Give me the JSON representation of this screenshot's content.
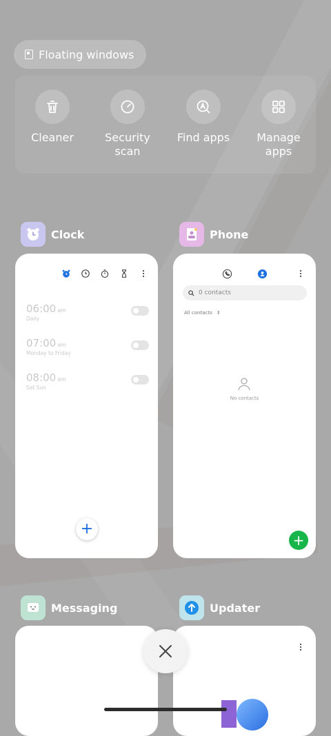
{
  "floating_windows": {
    "label": "Floating windows"
  },
  "tools": [
    {
      "label": "Cleaner",
      "icon": "trash-icon"
    },
    {
      "label": "Security scan",
      "icon": "speedometer-icon"
    },
    {
      "label": "Find apps",
      "icon": "find-apps-icon"
    },
    {
      "label": "Manage apps",
      "icon": "grid-icon"
    }
  ],
  "apps": {
    "clock": {
      "name": "Clock",
      "alarms": [
        {
          "time": "06:00",
          "ampm": "am",
          "repeat": "Daily"
        },
        {
          "time": "07:00",
          "ampm": "am",
          "repeat": "Monday to Friday"
        },
        {
          "time": "08:00",
          "ampm": "am",
          "repeat": "Sat Sun"
        }
      ]
    },
    "phone": {
      "name": "Phone",
      "search_placeholder": "0 contacts",
      "filter_label": "All contacts",
      "empty_label": "No contacts"
    },
    "messaging": {
      "name": "Messaging"
    },
    "updater": {
      "name": "Updater"
    }
  },
  "colors": {
    "accent_blue": "#1e6fe0",
    "fab_green": "#17b54a",
    "clock_icon_bg": "#c9c6ef",
    "phone_icon_bg": "#e6b8e8",
    "messaging_icon_bg": "#bfe3d2",
    "updater_icon_bg": "#bfe4ec"
  }
}
